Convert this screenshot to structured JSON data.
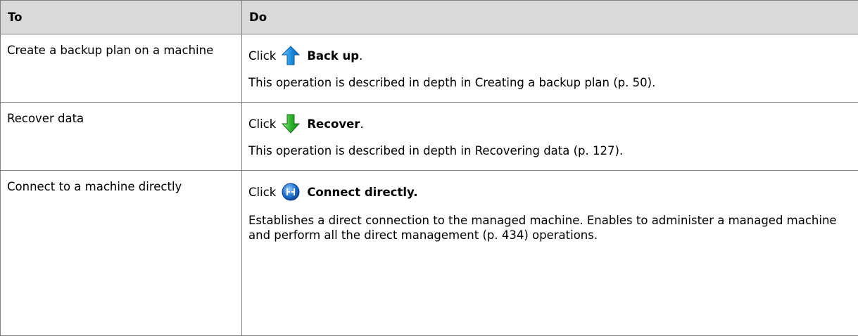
{
  "table": {
    "headers": {
      "col_to": "To",
      "col_do": "Do"
    },
    "rows": [
      {
        "task": "Create a backup plan on a machine",
        "click_word": "Click",
        "icon": "arrow-up-icon",
        "action_label": "Back up",
        "action_suffix": ".",
        "description": "This operation is described in depth in Creating a backup plan (p. 50)."
      },
      {
        "task": "Recover data",
        "click_word": "Click",
        "icon": "arrow-down-icon",
        "action_label": "Recover",
        "action_suffix": ".",
        "description": "This operation is described in depth in Recovering data (p. 127)."
      },
      {
        "task": "Connect to a machine directly",
        "click_word": "Click",
        "icon": "connect-icon",
        "action_label": "Connect directly.",
        "action_suffix": "",
        "description": "Establishes a direct connection to the managed machine. Enables to administer a managed machine and perform all the direct management (p. 434) operations."
      }
    ]
  },
  "colors": {
    "header_bg": "#d9d9d9",
    "border": "#7f7f7f",
    "up_arrow": "#1e90e0",
    "down_arrow": "#2fb52f",
    "connect": "#1565c0"
  }
}
